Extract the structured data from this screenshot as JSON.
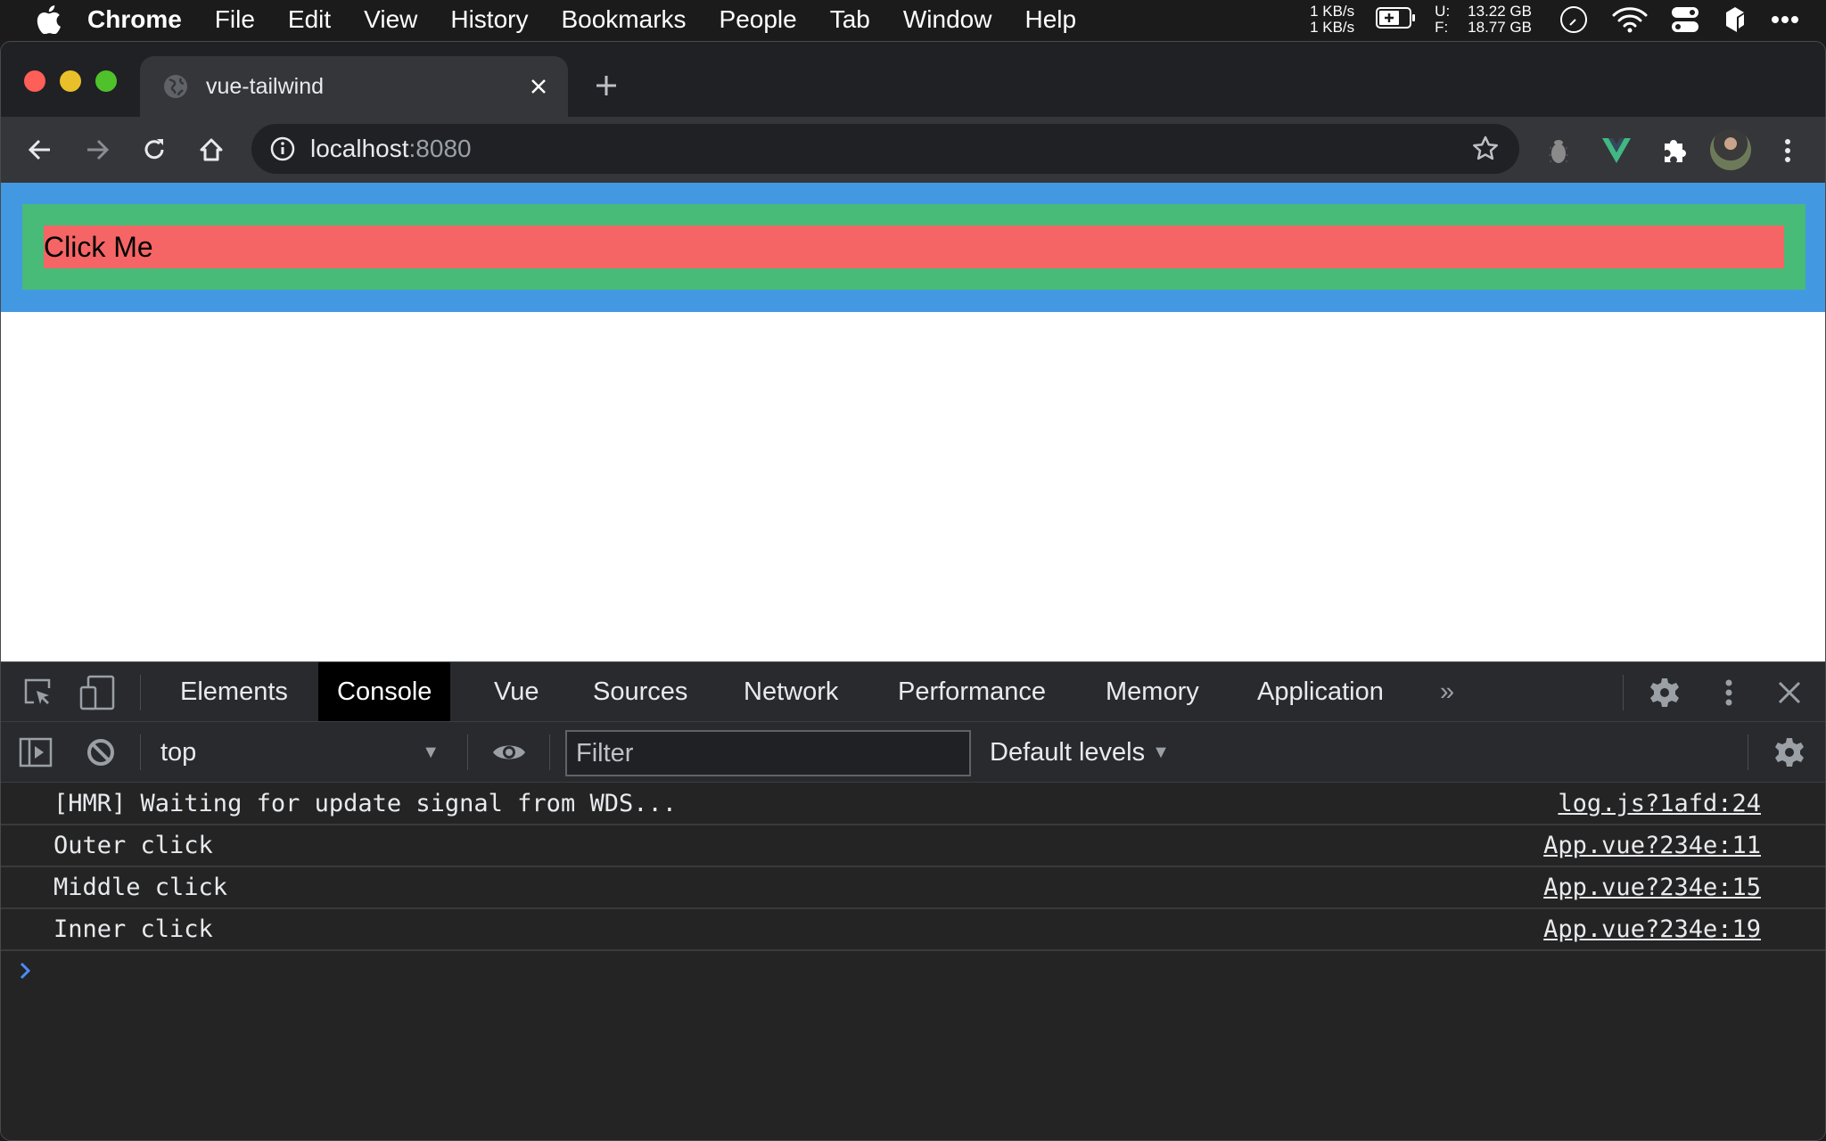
{
  "menubar": {
    "app_name": "Chrome",
    "items": [
      "File",
      "Edit",
      "View",
      "History",
      "Bookmarks",
      "People",
      "Tab",
      "Window",
      "Help"
    ],
    "netspeed": {
      "up": "1 KB/s",
      "down": "1 KB/s"
    },
    "memory": {
      "used_label": "U:",
      "used_value": "13.22 GB",
      "free_label": "F:",
      "free_value": "18.77 GB"
    }
  },
  "browser": {
    "tab": {
      "title": "vue-tailwind",
      "favicon": "globe-icon"
    },
    "address": {
      "host": "localhost",
      "port": ":8080"
    },
    "extensions": [
      "bug-extension-icon",
      "vue-devtools-icon",
      "puzzle-extensions-icon"
    ]
  },
  "page": {
    "button_label": "Click Me",
    "colors": {
      "outer": "#4299e1",
      "middle": "#48bb78",
      "inner": "#f56565"
    }
  },
  "devtools": {
    "tabs": [
      {
        "label": "Elements",
        "active": false
      },
      {
        "label": "Console",
        "active": true
      },
      {
        "label": "Vue",
        "active": false
      },
      {
        "label": "Sources",
        "active": false
      },
      {
        "label": "Network",
        "active": false
      },
      {
        "label": "Performance",
        "active": false
      },
      {
        "label": "Memory",
        "active": false
      },
      {
        "label": "Application",
        "active": false
      }
    ],
    "more_tabs": "»",
    "context": "top",
    "filter_placeholder": "Filter",
    "levels": "Default levels",
    "logs": [
      {
        "message": "[HMR] Waiting for update signal from WDS...",
        "source": "log.js?1afd:24"
      },
      {
        "message": "Outer click",
        "source": "App.vue?234e:11"
      },
      {
        "message": "Middle click",
        "source": "App.vue?234e:15"
      },
      {
        "message": "Inner click",
        "source": "App.vue?234e:19"
      }
    ]
  }
}
